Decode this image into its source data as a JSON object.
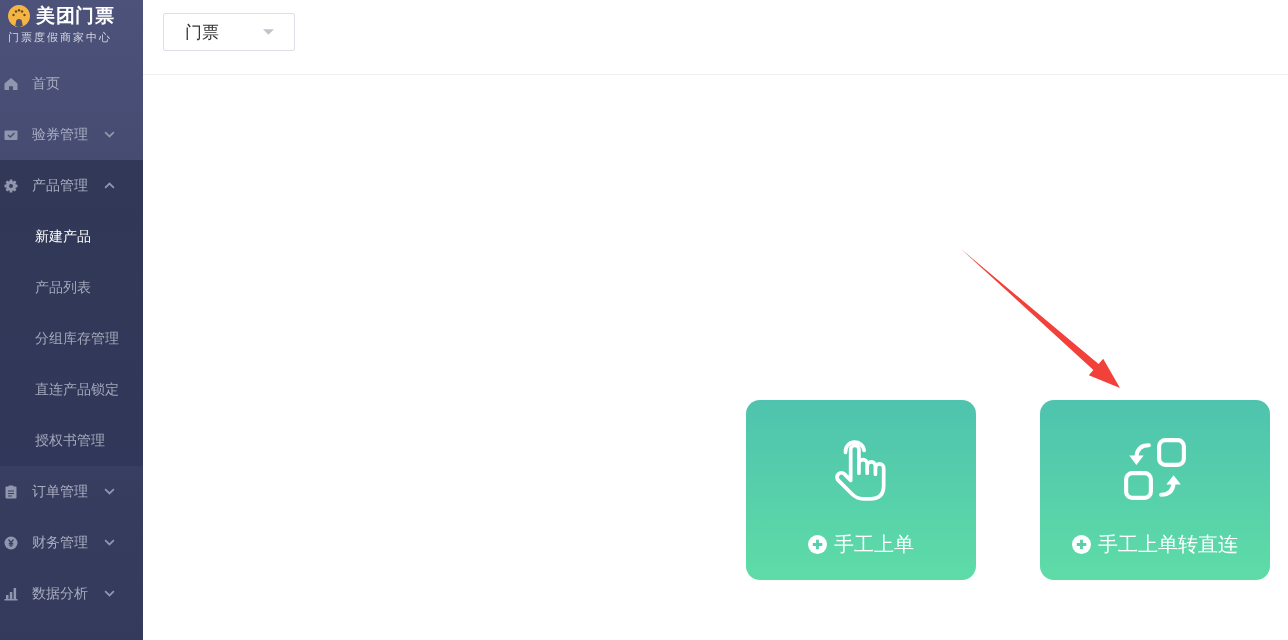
{
  "brand": {
    "title": "美团门票",
    "subtitle": "门票度假商家中心"
  },
  "sidebar": {
    "items": [
      {
        "label": "首页",
        "kind": "link"
      },
      {
        "label": "验券管理",
        "kind": "group",
        "expanded": false
      },
      {
        "label": "产品管理",
        "kind": "group",
        "expanded": true,
        "children": [
          {
            "label": "新建产品",
            "selected": true
          },
          {
            "label": "产品列表",
            "selected": false
          },
          {
            "label": "分组库存管理",
            "selected": false
          },
          {
            "label": "直连产品锁定",
            "selected": false
          },
          {
            "label": "授权书管理",
            "selected": false
          }
        ]
      },
      {
        "label": "订单管理",
        "kind": "group",
        "expanded": false
      },
      {
        "label": "财务管理",
        "kind": "group",
        "expanded": false
      },
      {
        "label": "数据分析",
        "kind": "group",
        "expanded": false
      }
    ]
  },
  "header": {
    "select": {
      "value": "门票"
    }
  },
  "cards": [
    {
      "label": "手工上单"
    },
    {
      "label": "手工上单转直连"
    }
  ]
}
